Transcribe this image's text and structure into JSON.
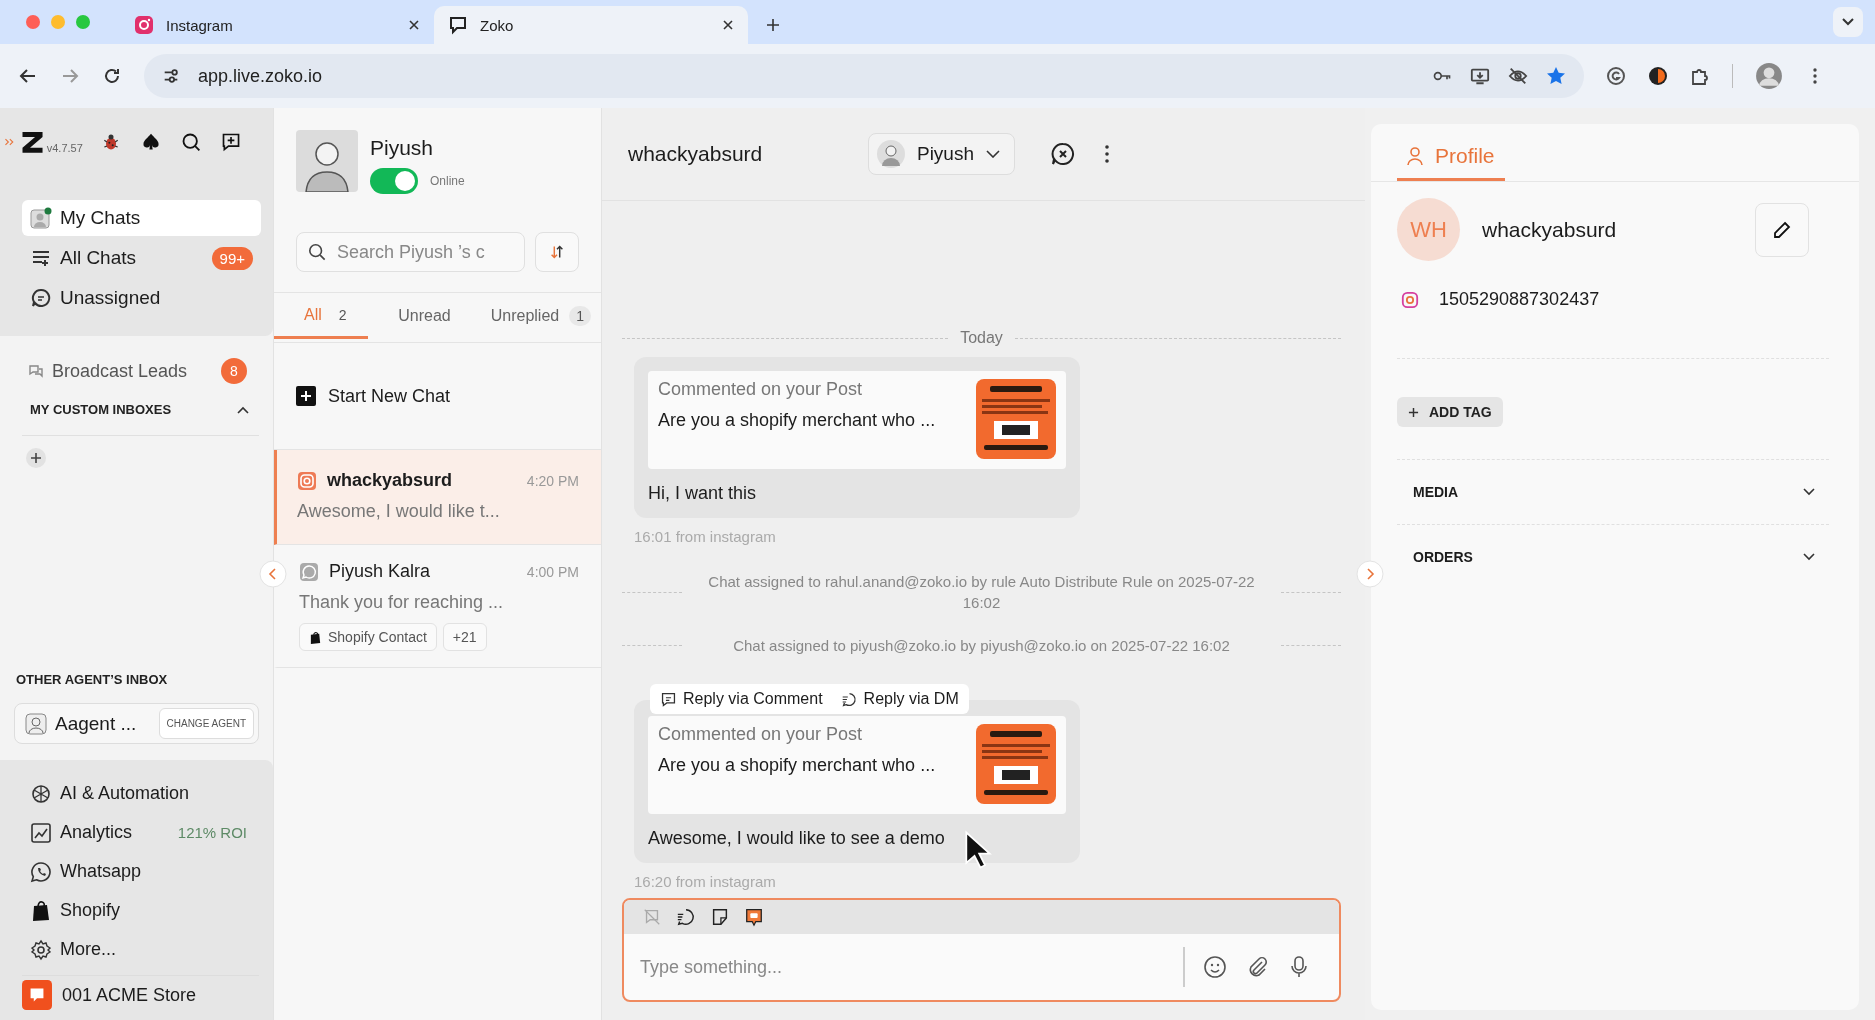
{
  "browser": {
    "tabs": [
      {
        "title": "Instagram",
        "kind": "instagram",
        "selected": false
      },
      {
        "title": "Zoko",
        "kind": "zoko",
        "selected": true
      }
    ],
    "url": "app.live.zoko.io"
  },
  "sidebar": {
    "version": "v4.7.57",
    "nav": [
      {
        "label": "My Chats",
        "kind": "avatar",
        "selected": true
      },
      {
        "label": "All Chats",
        "kind": "list",
        "badge": "99+",
        "selected": false
      },
      {
        "label": "Unassigned",
        "kind": "chat",
        "selected": false
      }
    ],
    "broadcast": {
      "label": "Broadcast Leads",
      "badge": "8"
    },
    "custom_inboxes": {
      "title": "MY CUSTOM INBOXES",
      "expanded": true
    },
    "other_agent": {
      "title": "OTHER AGENT’S INBOX",
      "agent": "Aagent ...",
      "button": "CHANGE AGENT"
    },
    "links": [
      {
        "label": "AI & Automation",
        "kind": "ai"
      },
      {
        "label": "Analytics",
        "kind": "analytics",
        "note": "121% ROI"
      },
      {
        "label": "Whatsapp",
        "kind": "whatsapp"
      },
      {
        "label": "Shopify",
        "kind": "shopify"
      },
      {
        "label": "More...",
        "kind": "more"
      }
    ],
    "store": "001 ACME Store"
  },
  "agent_panel": {
    "name": "Piyush",
    "online": true,
    "status": "Online",
    "search_placeholder": "Search Piyush ’s c",
    "filters": [
      {
        "label": "All",
        "count": "2",
        "selected": true
      },
      {
        "label": "Unread",
        "selected": false
      },
      {
        "label": "Unreplied",
        "count": "1",
        "selected": false
      }
    ],
    "start_chat": "Start New Chat",
    "chats": [
      {
        "name": "whackyabsurd",
        "kind": "instagram",
        "time": "4:20 PM",
        "preview": "Awesome, I would like t...",
        "selected": true
      },
      {
        "name": "Piyush Kalra",
        "kind": "whatsapp",
        "time": "4:00 PM",
        "preview": "Thank you for reaching ...",
        "selected": false,
        "tags": [
          {
            "label": "Shopify Contact",
            "kind": "shopify"
          },
          {
            "label": "+21",
            "kind": "plain"
          }
        ]
      }
    ]
  },
  "chat": {
    "title": "whackyabsurd",
    "assignee": "Piyush",
    "date_divider": "Today",
    "events": [
      {
        "kind": "message",
        "post_label": "Commented on your Post",
        "post_text": "Are you a shopify merchant who ...",
        "text": "Hi, I want this",
        "meta": "16:01 from instagram"
      },
      {
        "kind": "system",
        "text": "Chat assigned to rahul.anand@zoko.io by rule Auto Distribute Rule on 2025-07-22 16:02"
      },
      {
        "kind": "system",
        "text": "Chat assigned to piyush@zoko.io by piyush@zoko.io on 2025-07-22 16:02"
      },
      {
        "kind": "message",
        "actions": [
          "Reply via Comment",
          "Reply via DM"
        ],
        "post_label": "Commented on your Post",
        "post_text": "Are you a shopify merchant who ...",
        "text": "Awesome, I would like to see a demo",
        "meta": "16:20 from instagram"
      }
    ],
    "composer": {
      "placeholder": "Type something..."
    }
  },
  "profile": {
    "tab": {
      "label": "Profile",
      "selected": true
    },
    "initials": "WH",
    "name": "whackyabsurd",
    "instagram_id": "1505290887302437",
    "add_tag": "ADD TAG",
    "sections": [
      {
        "title": "MEDIA",
        "expanded": false
      },
      {
        "title": "ORDERS",
        "expanded": false
      }
    ]
  }
}
